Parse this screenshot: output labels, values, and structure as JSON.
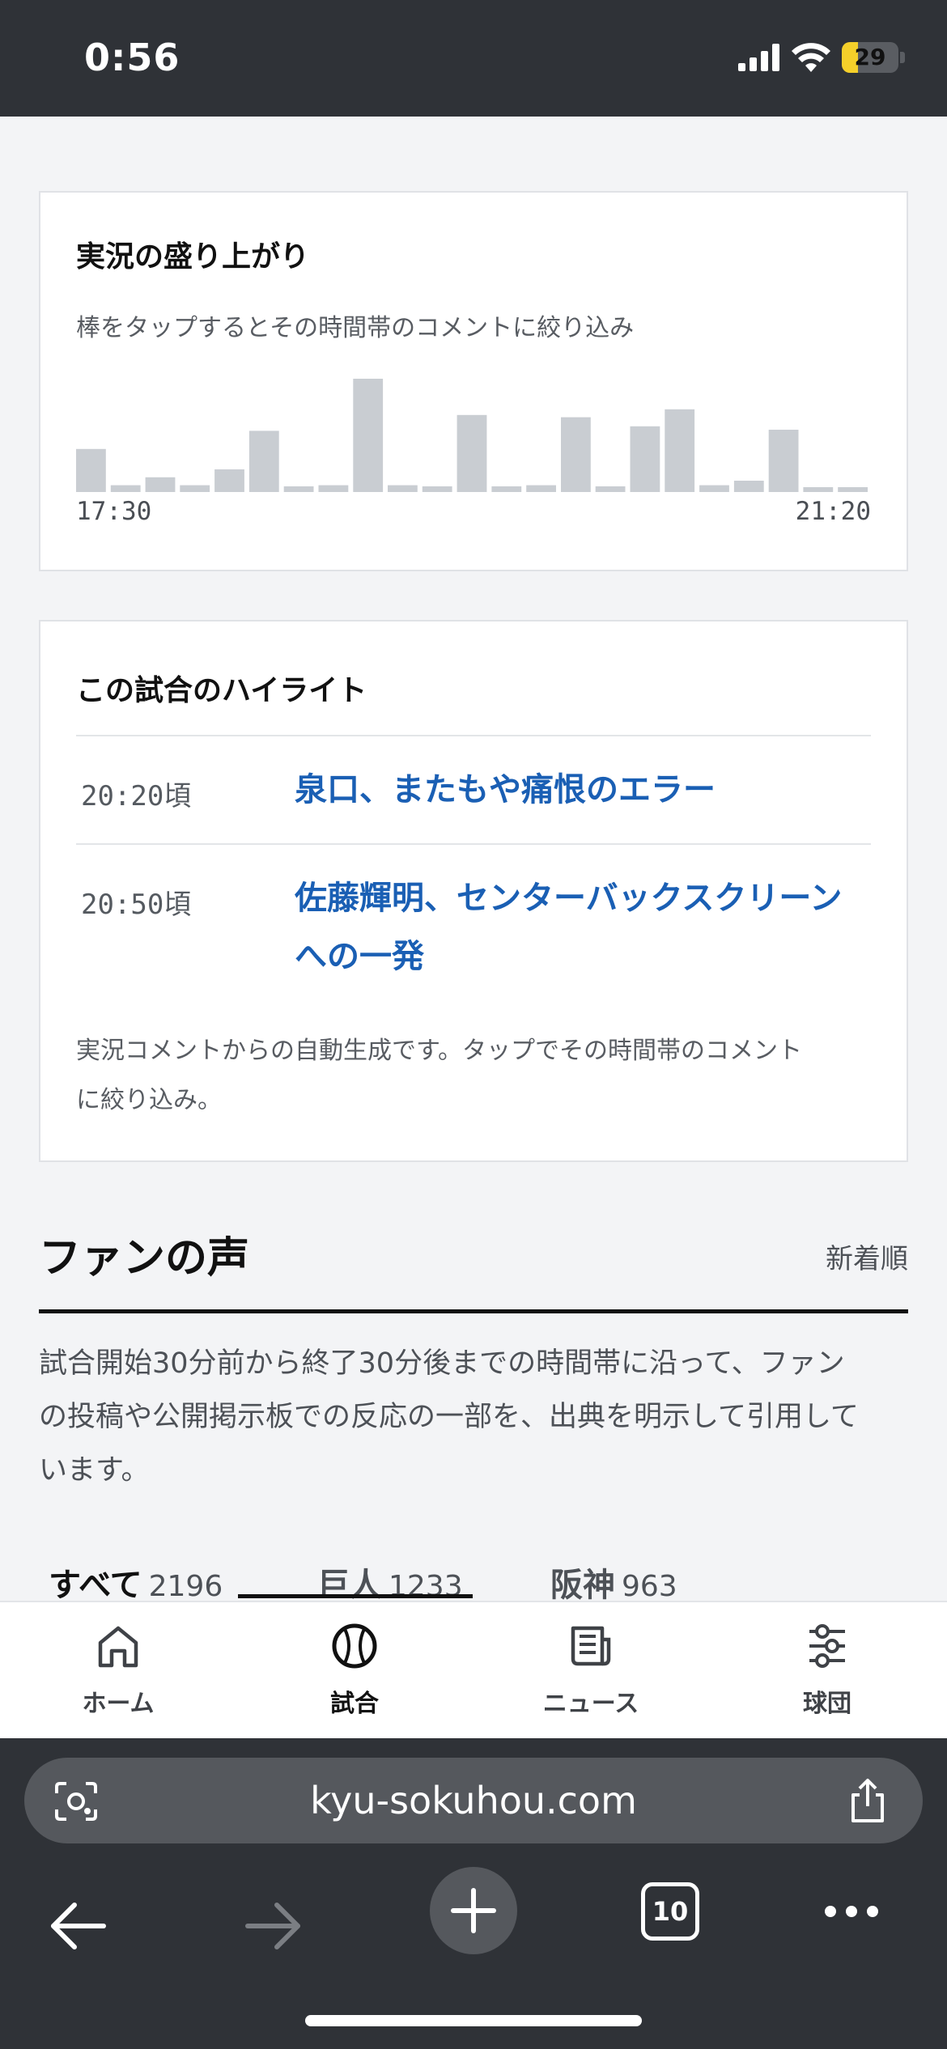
{
  "status": {
    "time": "0:56",
    "battery": "29",
    "battery_level": 0.29
  },
  "excitement": {
    "title": "実況の盛り上がり",
    "subtitle": "棒をタップするとその時間帯のコメントに絞り込み",
    "start_label": "17:30",
    "end_label": "21:20"
  },
  "chart_data": {
    "type": "bar",
    "title": "実況の盛り上がり",
    "x_start": "17:30",
    "x_end": "21:20",
    "bar_color": "#c9cdd2",
    "values": [
      38,
      6,
      13,
      6,
      20,
      54,
      5,
      6,
      100,
      6,
      5,
      68,
      5,
      6,
      66,
      5,
      58,
      73,
      6,
      10,
      55,
      4,
      4
    ]
  },
  "highlights": {
    "title": "この試合のハイライト",
    "items": [
      {
        "time": "20:20頃",
        "text": "泉口、またもや痛恨のエラー"
      },
      {
        "time": "20:50頃",
        "line1": "佐藤輝明、センターバックスクリーン",
        "line2": "への一発"
      }
    ],
    "note_line1": "実況コメントからの自動生成です。タップでその時間帯のコメント",
    "note_line2": "に絞り込み。"
  },
  "fans": {
    "title": "ファンの声",
    "sort": "新着順",
    "desc_line1": "試合開始30分前から終了30分後までの時間帯に沿って、ファン",
    "desc_line2": "の投稿や公開掲示板での反応の一部を、出典を明示して引用して",
    "desc_line3": "います。",
    "tabs": [
      {
        "label": "すべて",
        "count": "2196"
      },
      {
        "label": "巨人",
        "count": "1233"
      },
      {
        "label": "阪神",
        "count": "963"
      }
    ]
  },
  "nav": {
    "items": [
      {
        "label": "ホーム",
        "icon": "home-icon"
      },
      {
        "label": "試合",
        "icon": "baseball-icon"
      },
      {
        "label": "ニュース",
        "icon": "news-icon"
      },
      {
        "label": "球団",
        "icon": "team-icon"
      }
    ],
    "active": "試合"
  },
  "browser": {
    "url": "kyu-sokuhou.com",
    "tab_count": "10"
  }
}
